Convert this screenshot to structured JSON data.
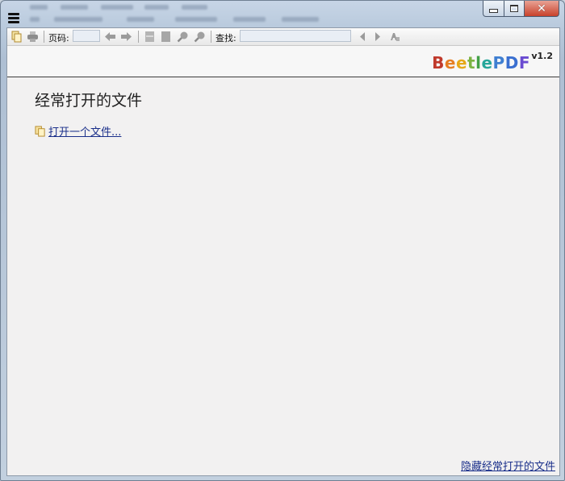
{
  "toolbar": {
    "page_label": "页码:",
    "page_value": "",
    "find_label": "查找:",
    "find_value": ""
  },
  "logo": {
    "letters": [
      {
        "ch": "B",
        "color": "#c0392b"
      },
      {
        "ch": "e",
        "color": "#e67e22"
      },
      {
        "ch": "e",
        "color": "#e6a817"
      },
      {
        "ch": "t",
        "color": "#7cb342"
      },
      {
        "ch": "l",
        "color": "#43a047"
      },
      {
        "ch": "e",
        "color": "#26a69a"
      },
      {
        "ch": "P",
        "color": "#3f7fd1"
      },
      {
        "ch": "D",
        "color": "#3a6fd0"
      },
      {
        "ch": "F",
        "color": "#6a4bd1"
      }
    ],
    "version": "v1.2"
  },
  "main": {
    "recent_title": "经常打开的文件",
    "open_file_label": "打开一个文件...",
    "hide_recent_label": "隐藏经常打开的文件"
  },
  "icons": {
    "open": "folder-open-icon",
    "print": "printer-icon",
    "prev": "arrow-left-icon",
    "next": "arrow-right-icon",
    "single_page": "single-page-icon",
    "facing_page": "facing-page-icon",
    "zoom_in": "zoom-in-icon",
    "zoom_out": "zoom-out-icon",
    "find_prev": "find-prev-icon",
    "find_next": "find-next-icon",
    "match_case": "match-case-icon"
  }
}
